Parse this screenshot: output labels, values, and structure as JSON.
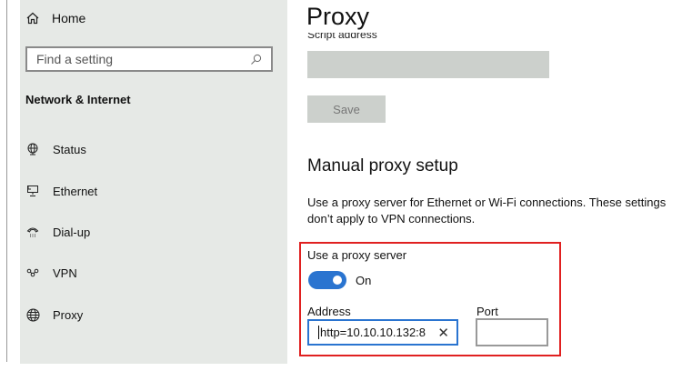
{
  "sidebar": {
    "home_label": "Home",
    "search_placeholder": "Find a setting",
    "section_title": "Network & Internet",
    "items": [
      {
        "label": "Status",
        "icon": "globe-monitor-icon"
      },
      {
        "label": "Ethernet",
        "icon": "ethernet-icon"
      },
      {
        "label": "Dial-up",
        "icon": "dialup-phone-icon"
      },
      {
        "label": "VPN",
        "icon": "vpn-icon"
      },
      {
        "label": "Proxy",
        "icon": "globe-icon"
      }
    ]
  },
  "main": {
    "title": "Proxy",
    "script_address_label": "Script address",
    "save_label": "Save",
    "manual_heading": "Manual proxy setup",
    "description": "Use a proxy server for Ethernet or Wi-Fi connections. These settings don’t apply to VPN connections.",
    "use_proxy_label": "Use a proxy server",
    "toggle_state": "On",
    "address_label": "Address",
    "address_value": "http=10.10.10.132:8",
    "port_label": "Port",
    "port_value": ""
  },
  "colors": {
    "accent": "#2a74d0",
    "highlight": "#e02020"
  }
}
